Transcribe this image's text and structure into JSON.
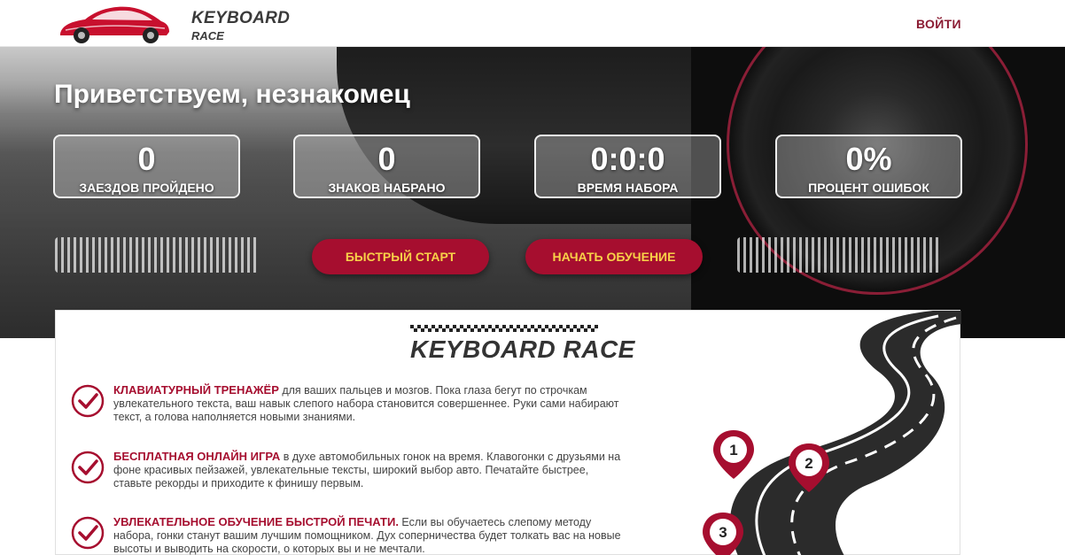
{
  "header": {
    "logo_line1": "KEYBOARD",
    "logo_line2": "RACE",
    "login_label": "ВОЙТИ"
  },
  "hero": {
    "greeting": "Приветствуем, незнакомец",
    "stats": [
      {
        "value": "0",
        "label": "ЗАЕЗДОВ ПРОЙДЕНО"
      },
      {
        "value": "0",
        "label": "ЗНАКОВ НАБРАНО"
      },
      {
        "value": "0:0:0",
        "label": "ВРЕМЯ НАБОРА"
      },
      {
        "value": "0%",
        "label": "ПРОЦЕНТ ОШИБОК"
      }
    ],
    "quick_start_label": "БЫСТРЫЙ СТАРТ",
    "start_learning_label": "НАЧАТЬ ОБУЧЕНИЕ"
  },
  "content": {
    "title": "KEYBOARD RACE",
    "features": [
      {
        "highlight": "КЛАВИАТУРНЫЙ ТРЕНАЖЁР",
        "text": " для ваших пальцев и мозгов. Пока глаза бегут по строчкам увлекательного текста, ваш навык слепого набора становится совершеннее. Руки сами набирают текст, а голова наполняется новыми знаниями."
      },
      {
        "highlight": "БЕСПЛАТНАЯ ОНЛАЙН ИГРА",
        "text": " в духе автомобильных гонок на время. Клавогонки с друзьями на фоне красивых пейзажей, увлекательные тексты, широкий выбор авто. Печатайте быстрее, ставьте рекорды и приходите к финишу первым."
      },
      {
        "highlight": "УВЛЕКАТЕЛЬНОЕ ОБУЧЕНИЕ БЫСТРОЙ ПЕЧАТИ.",
        "text": " Если вы обучаетесь слепому методу набора, гонки станут вашим лучшим помощником. Дух соперничества будет толкать вас на новые высоты и выводить на скорости, о которых вы и не мечтали."
      }
    ],
    "road_markers": [
      "1",
      "2",
      "3"
    ]
  },
  "colors": {
    "brand": "#a60e2f",
    "button_text": "#f8d148",
    "login": "#8b1c33"
  }
}
